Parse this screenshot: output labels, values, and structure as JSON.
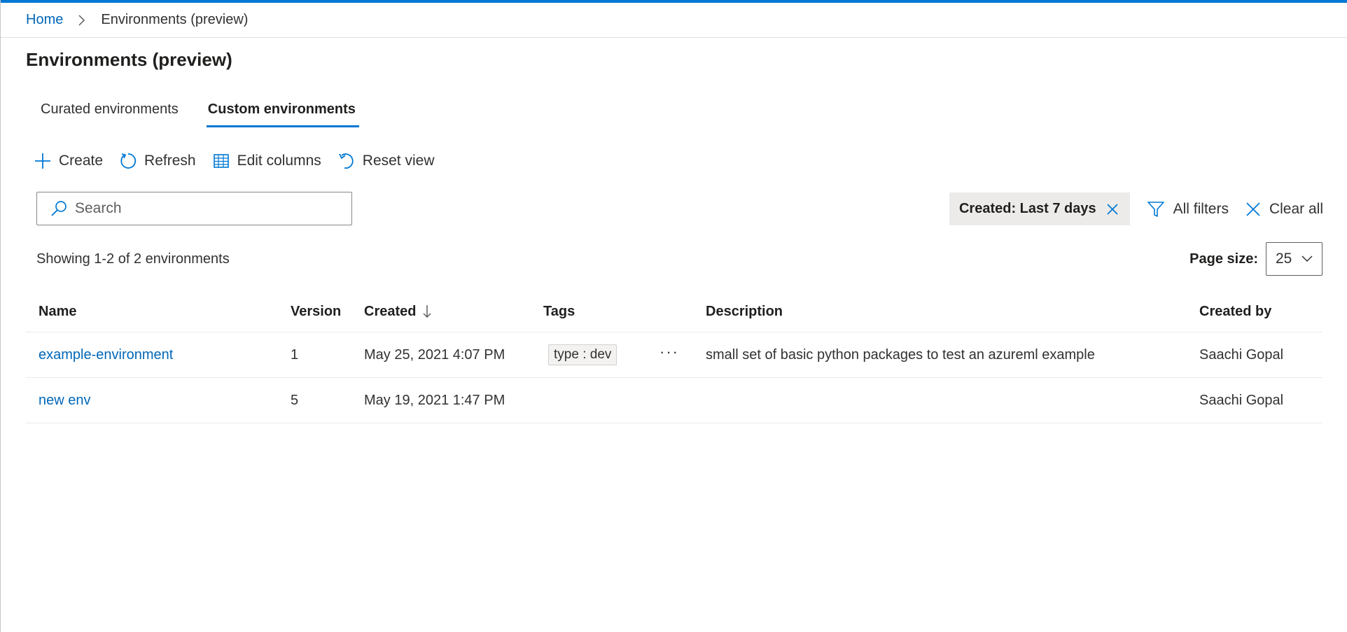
{
  "breadcrumb": {
    "home": "Home",
    "current": "Environments (preview)"
  },
  "page": {
    "title": "Environments (preview)"
  },
  "tabs": [
    {
      "label": "Curated environments",
      "selected": false
    },
    {
      "label": "Custom environments",
      "selected": true
    }
  ],
  "toolbar": {
    "create": "Create",
    "refresh": "Refresh",
    "edit_columns": "Edit columns",
    "reset_view": "Reset view"
  },
  "search": {
    "placeholder": "Search",
    "value": ""
  },
  "filters": {
    "active_chip": "Created: Last 7 days",
    "all_filters": "All filters",
    "clear_all": "Clear all"
  },
  "summary": {
    "showing": "Showing 1-2 of 2 environments"
  },
  "pagesize": {
    "label": "Page size:",
    "value": "25"
  },
  "table": {
    "columns": {
      "name": "Name",
      "version": "Version",
      "created": "Created",
      "tags": "Tags",
      "description": "Description",
      "created_by": "Created by"
    },
    "rows": [
      {
        "name": "example-environment",
        "version": "1",
        "created": "May 25, 2021 4:07 PM",
        "tag": "type : dev",
        "more": "···",
        "description": "small set of basic python packages to test an azureml example",
        "created_by": "Saachi Gopal"
      },
      {
        "name": "new env",
        "version": "5",
        "created": "May 19, 2021 1:47 PM",
        "tag": "",
        "more": "",
        "description": "",
        "created_by": "Saachi Gopal"
      }
    ]
  },
  "colors": {
    "accent": "#0078d4",
    "link": "#0067b8",
    "chip_bg": "#edebe9"
  },
  "icons": {
    "breadcrumb_sep": "chevron-right-icon",
    "create": "plus-icon",
    "refresh": "refresh-icon",
    "edit_columns": "columns-icon",
    "reset_view": "undo-icon",
    "search": "search-icon",
    "chip_remove": "close-icon",
    "all_filters": "filter-icon",
    "clear_all": "close-icon",
    "pagesize": "chevron-down-icon",
    "sort": "arrow-down-icon"
  }
}
